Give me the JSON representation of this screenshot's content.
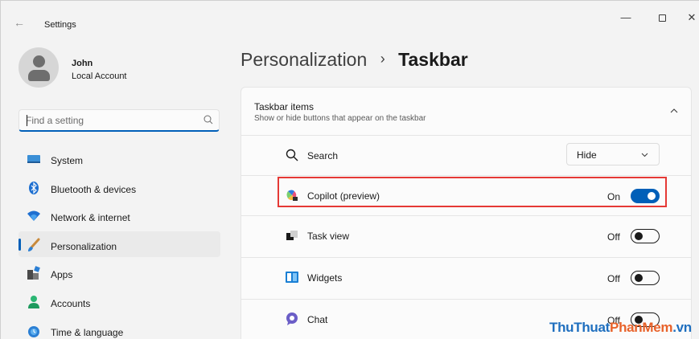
{
  "window": {
    "title": "Settings",
    "minimize_glyph": "—",
    "close_glyph": "✕",
    "back_glyph": "←"
  },
  "profile": {
    "name": "John",
    "account_type": "Local Account"
  },
  "search": {
    "placeholder": "Find a setting"
  },
  "sidebar": {
    "items": [
      {
        "label": "System",
        "icon": "monitor-icon",
        "active": false
      },
      {
        "label": "Bluetooth & devices",
        "icon": "bluetooth-icon",
        "active": false
      },
      {
        "label": "Network & internet",
        "icon": "wifi-icon",
        "active": false
      },
      {
        "label": "Personalization",
        "icon": "brush-icon",
        "active": true
      },
      {
        "label": "Apps",
        "icon": "apps-icon",
        "active": false
      },
      {
        "label": "Accounts",
        "icon": "person-icon",
        "active": false
      },
      {
        "label": "Time & language",
        "icon": "globe-clock-icon",
        "active": false
      }
    ]
  },
  "breadcrumb": {
    "parent": "Personalization",
    "separator": "›",
    "current": "Taskbar"
  },
  "card": {
    "title": "Taskbar items",
    "subtitle": "Show or hide buttons that appear on the taskbar",
    "rows": [
      {
        "label": "Search",
        "icon": "search-icon",
        "control": "dropdown",
        "value": "Hide"
      },
      {
        "label": "Copilot (preview)",
        "icon": "copilot-icon",
        "control": "toggle",
        "state": "On",
        "on": true
      },
      {
        "label": "Task view",
        "icon": "task-view-icon",
        "control": "toggle",
        "state": "Off",
        "on": false
      },
      {
        "label": "Widgets",
        "icon": "widgets-icon",
        "control": "toggle",
        "state": "Off",
        "on": false
      },
      {
        "label": "Chat",
        "icon": "chat-icon",
        "control": "toggle",
        "state": "Off",
        "on": false
      }
    ]
  },
  "watermark": {
    "part1": "ThuThuat",
    "part2": "PhanMem",
    "part3": ".vn"
  },
  "colors": {
    "accent": "#005fb8",
    "highlight_border": "#e53935",
    "background": "#f3f3f3",
    "card": "#fbfbfb"
  }
}
